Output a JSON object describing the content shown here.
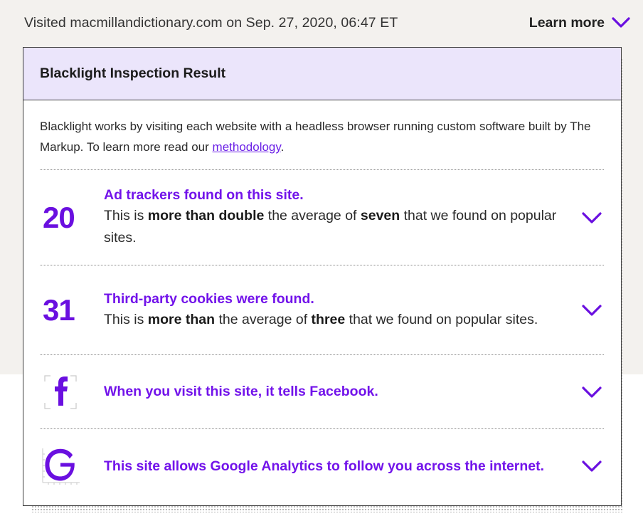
{
  "visited": {
    "text": "Visited macmillandictionary.com on Sep. 27, 2020, 06:47 ET",
    "learn_more": "Learn more"
  },
  "card": {
    "title": "Blacklight Inspection Result",
    "intro_before": "Blacklight works by visiting each website with a headless browser running custom software built by The Markup. To learn more read our ",
    "intro_link": "methodology",
    "intro_after": "."
  },
  "findings": [
    {
      "number": "20",
      "title": "Ad trackers found on this site.",
      "desc_1": "This is ",
      "desc_bold_1": "more than double",
      "desc_2": " the average of ",
      "desc_bold_2": "seven",
      "desc_3": " that we found on popular sites."
    },
    {
      "number": "31",
      "title": "Third-party cookies were found.",
      "desc_1": "This is ",
      "desc_bold_1": "more than",
      "desc_2": " the average of ",
      "desc_bold_2": "three",
      "desc_3": " that we found on popular sites."
    },
    {
      "icon": "facebook-icon",
      "title": "When you visit this site, it tells Facebook."
    },
    {
      "icon": "google-analytics-icon",
      "title": "This site allows Google Analytics to follow you across the internet."
    }
  ],
  "colors": {
    "accent": "#6a0fe0",
    "header_bg": "#ebe5fb",
    "page_bg": "#f3f1ee"
  }
}
